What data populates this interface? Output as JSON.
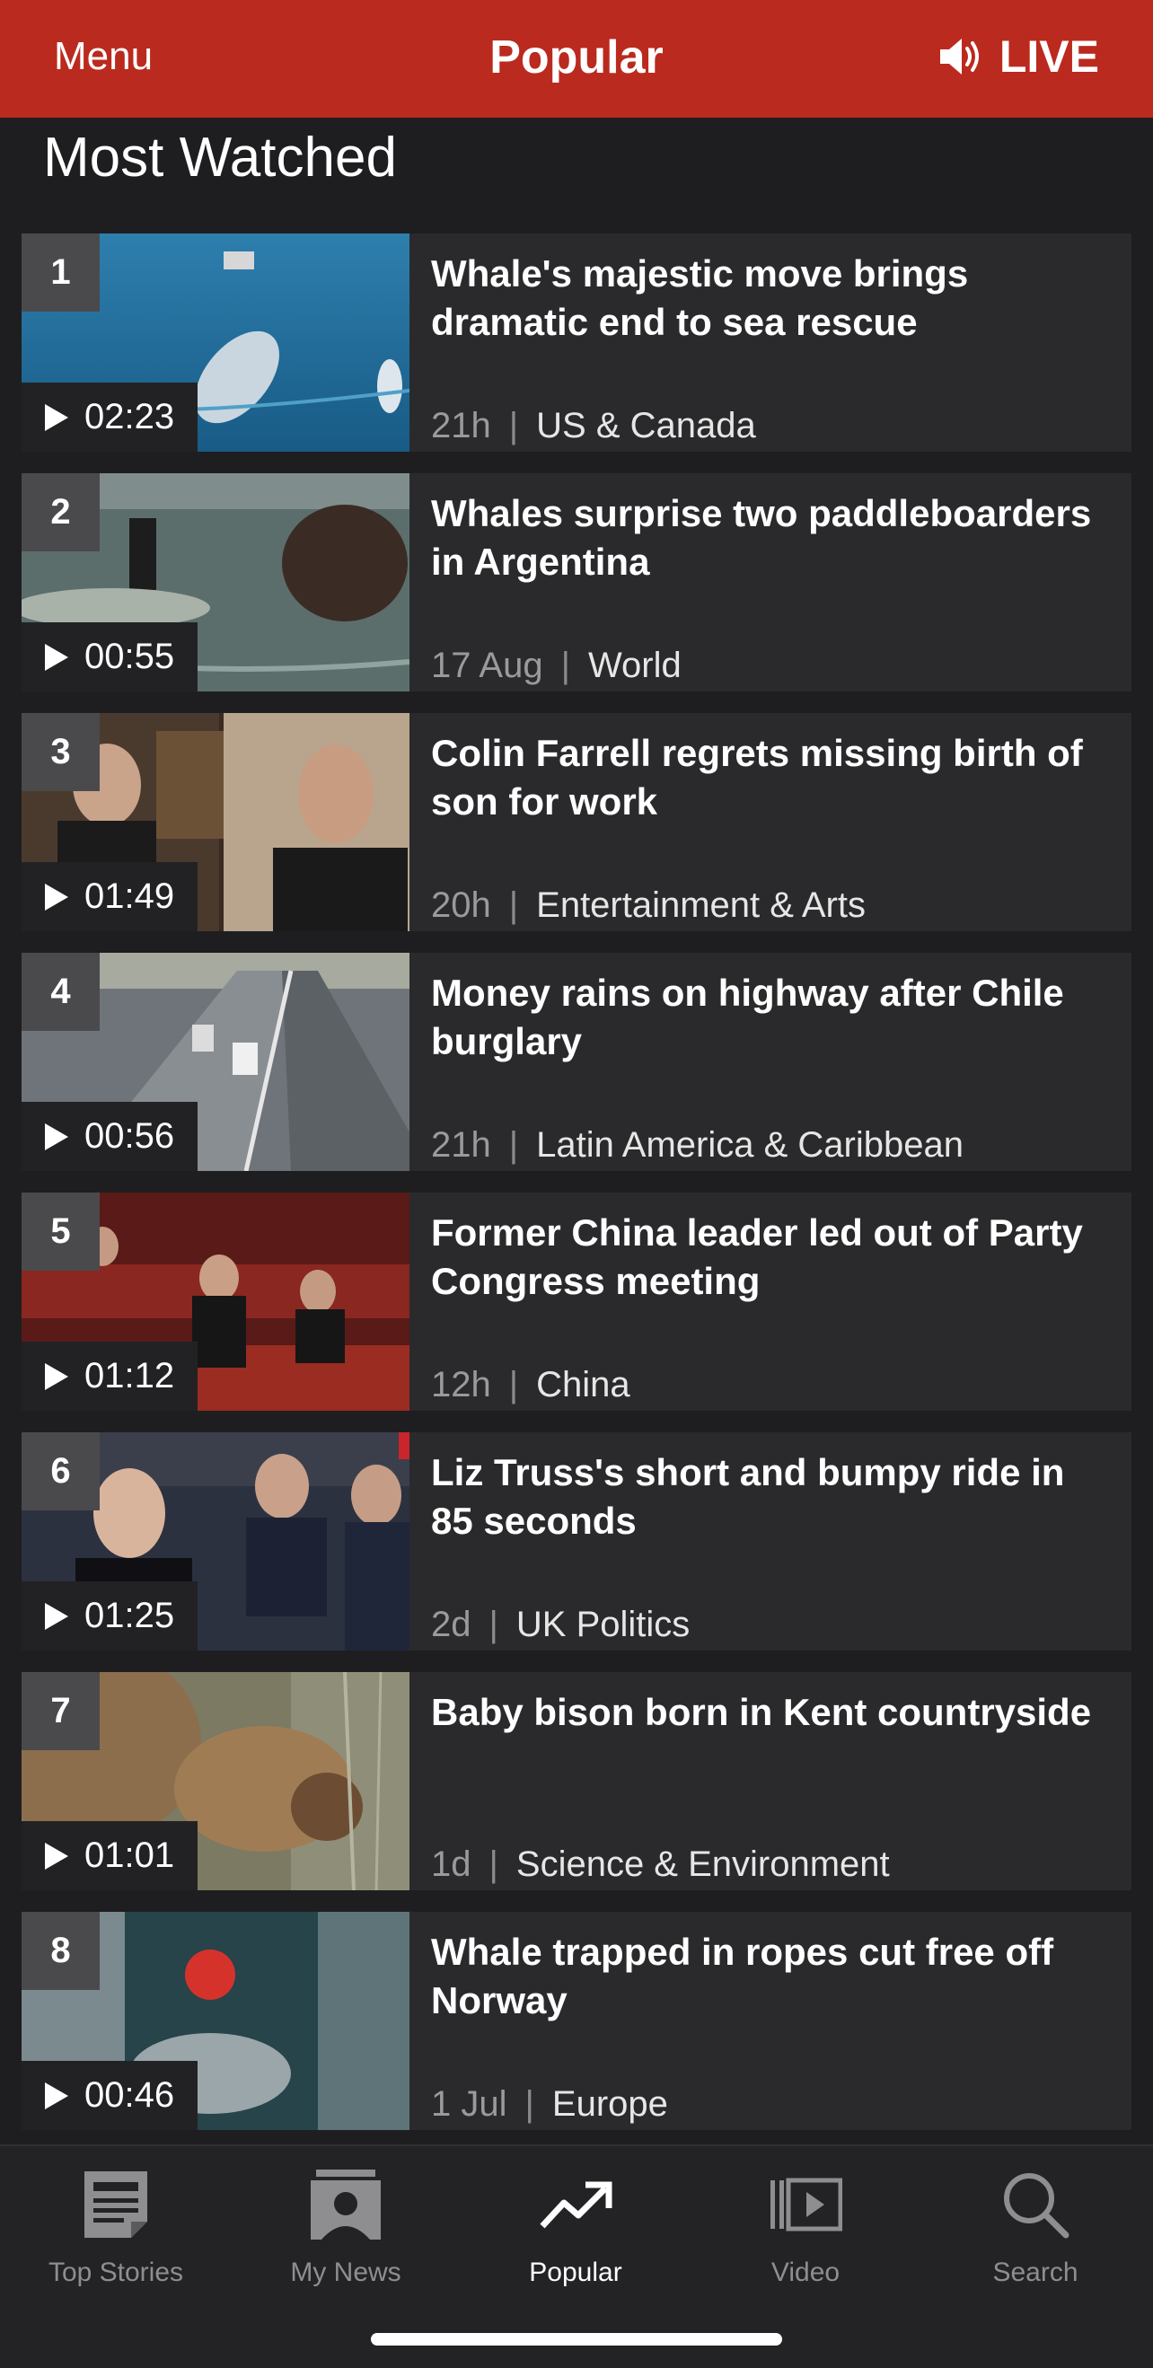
{
  "header": {
    "menu_label": "Menu",
    "title": "Popular",
    "live_label": "LIVE",
    "background": "#bb2a1f"
  },
  "section": {
    "title": "Most Watched"
  },
  "items": [
    {
      "rank": "1",
      "duration": "02:23",
      "headline": "Whale's majestic move brings dramatic end to sea rescue",
      "age": "21h",
      "category": "US & Canada"
    },
    {
      "rank": "2",
      "duration": "00:55",
      "headline": "Whales surprise two paddleboarders in Argentina",
      "age": "17 Aug",
      "category": "World"
    },
    {
      "rank": "3",
      "duration": "01:49",
      "headline": "Colin Farrell regrets missing birth of son for work",
      "age": "20h",
      "category": "Entertainment & Arts"
    },
    {
      "rank": "4",
      "duration": "00:56",
      "headline": "Money rains on highway after Chile burglary",
      "age": "21h",
      "category": "Latin America & Caribbean"
    },
    {
      "rank": "5",
      "duration": "01:12",
      "headline": "Former China leader led out of Party Congress meeting",
      "age": "12h",
      "category": "China"
    },
    {
      "rank": "6",
      "duration": "01:25",
      "headline": "Liz Truss's short and bumpy ride in 85 seconds",
      "age": "2d",
      "category": "UK Politics"
    },
    {
      "rank": "7",
      "duration": "01:01",
      "headline": "Baby bison born in Kent countryside",
      "age": "1d",
      "category": "Science & Environment"
    },
    {
      "rank": "8",
      "duration": "00:46",
      "headline": "Whale trapped in ropes cut free off Norway",
      "age": "1 Jul",
      "category": "Europe"
    }
  ],
  "separator": "|",
  "tabs": [
    {
      "label": "Top Stories",
      "icon": "newspaper-icon"
    },
    {
      "label": "My News",
      "icon": "my-news-icon"
    },
    {
      "label": "Popular",
      "icon": "trending-icon",
      "active": true
    },
    {
      "label": "Video",
      "icon": "video-icon"
    },
    {
      "label": "Search",
      "icon": "search-icon"
    }
  ]
}
